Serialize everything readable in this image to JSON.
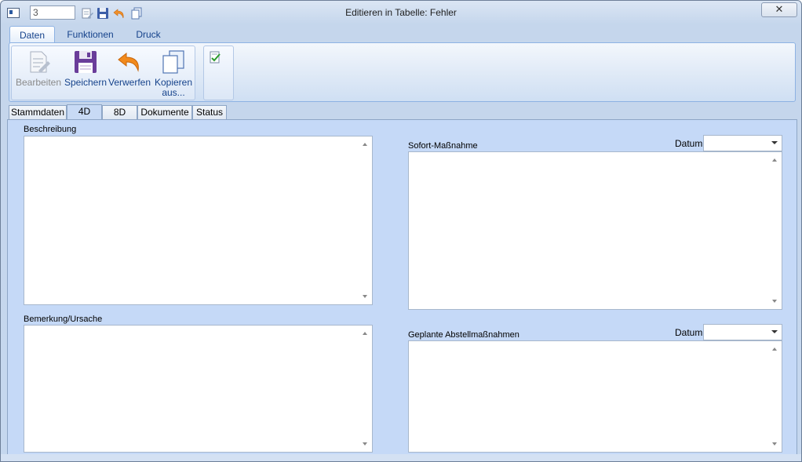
{
  "window": {
    "title": "Editieren in Tabelle: Fehler",
    "close_label": "✕",
    "record_number": "3"
  },
  "ribbon_tabs": [
    {
      "label": "Daten",
      "active": true
    },
    {
      "label": "Funktionen",
      "active": false
    },
    {
      "label": "Druck",
      "active": false
    }
  ],
  "ribbon": {
    "edit": {
      "line1": "Bearbeiten",
      "line2": "",
      "enabled": false
    },
    "save": {
      "line1": "Speichern",
      "line2": ""
    },
    "discard": {
      "line1": "Verwerfen",
      "line2": ""
    },
    "copy": {
      "line1": "Kopieren",
      "line2": "aus..."
    }
  },
  "form_tabs": [
    {
      "label": "Stammdaten",
      "active": false
    },
    {
      "label": "4D",
      "active": true
    },
    {
      "label": "8D",
      "active": false
    },
    {
      "label": "Dokumente",
      "active": false
    },
    {
      "label": "Status",
      "active": false
    }
  ],
  "fields": {
    "description": {
      "label": "Beschreibung",
      "value": ""
    },
    "remark_cause": {
      "label": "Bemerkung/Ursache",
      "value": ""
    },
    "immediate_action": {
      "label": "Sofort-Maßnahme",
      "date_label": "Datum",
      "date_value": "",
      "value": ""
    },
    "planned_actions": {
      "label": "Geplante Abstellmaßnahmen",
      "date_label": "Datum",
      "date_value": "",
      "value": ""
    }
  },
  "colors": {
    "ribbon_text": "#15428b",
    "panel_bg": "#c5d9f7",
    "save_icon": "#6a3d9a",
    "discard_icon": "#f28a1c"
  }
}
